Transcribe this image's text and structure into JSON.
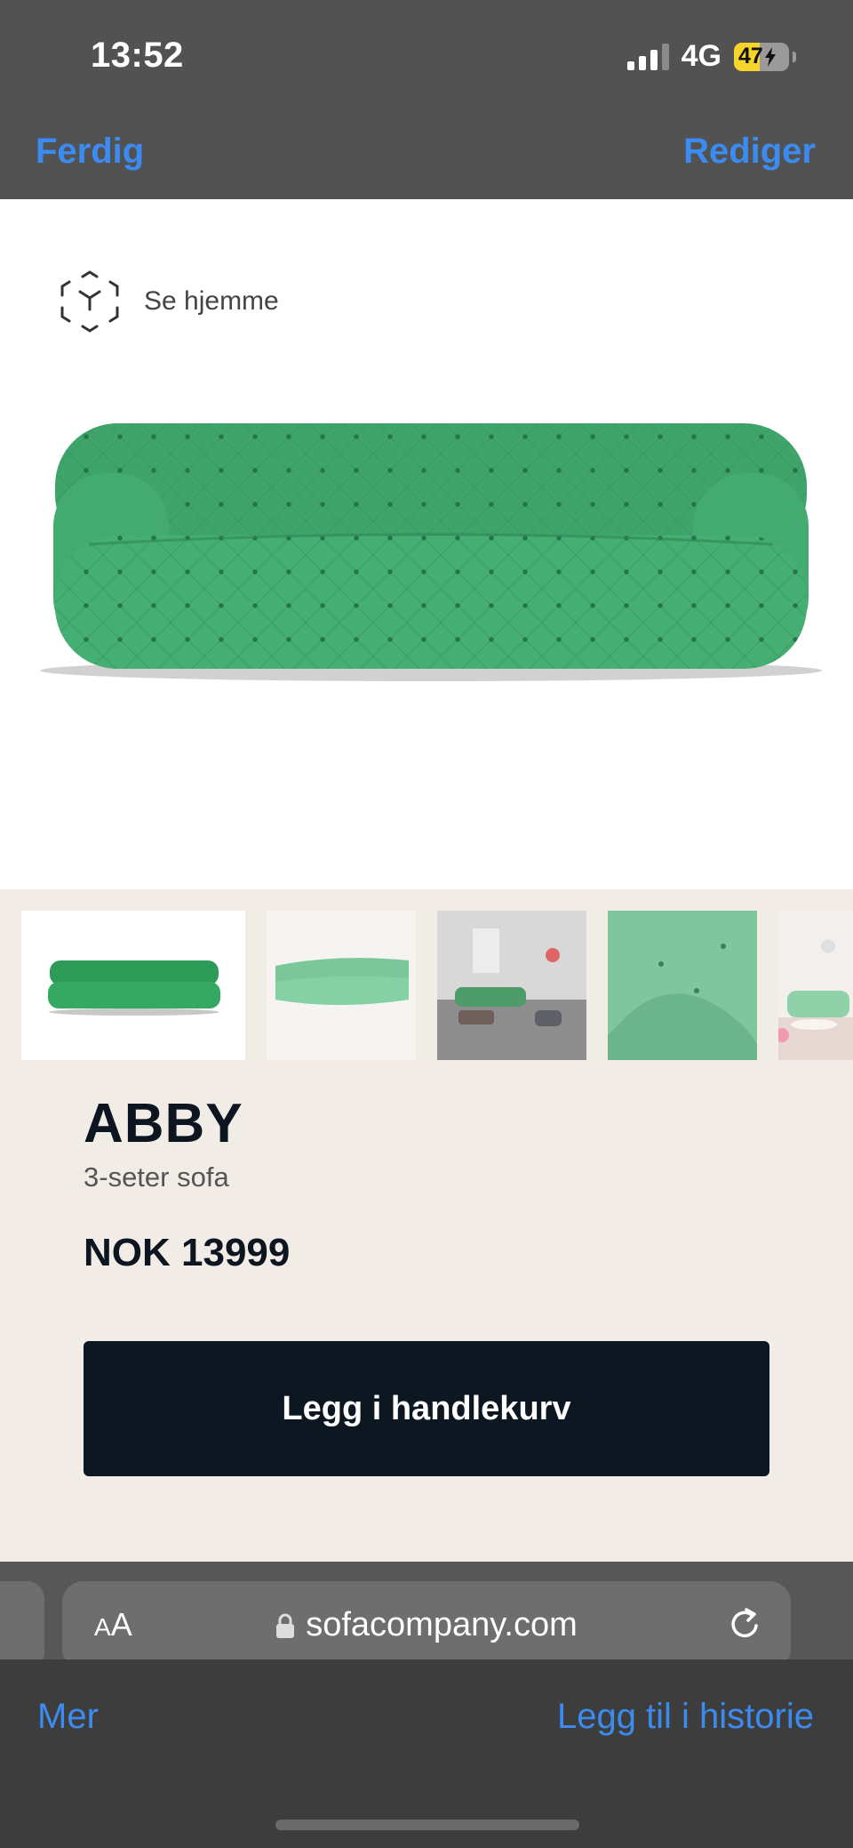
{
  "status_bar": {
    "time": "13:52",
    "network": "4G",
    "battery": "47",
    "battery_level": 0.47,
    "battery_color": "#f5d52b"
  },
  "nav": {
    "done_label": "Ferdig",
    "edit_label": "Rediger",
    "accent_color": "#3b8bf0"
  },
  "product": {
    "ar_label": "Se hjemme",
    "name": "ABBY",
    "subtitle": "3-seter sofa",
    "price": "NOK 13999",
    "cart_label": "Legg i handlekurv",
    "sofa_color": "#3fa46a"
  },
  "gallery": {
    "thumbnails": [
      "sofa-front-icon",
      "sofa-angle-icon",
      "room-scene-icon",
      "fabric-closeup-icon",
      "lounge-scene-icon"
    ]
  },
  "browser": {
    "aa_label": "AA",
    "url": "sofacompany.com"
  },
  "bottom_toolbar": {
    "more_label": "Mer",
    "add_story_label": "Legg til i historie"
  }
}
